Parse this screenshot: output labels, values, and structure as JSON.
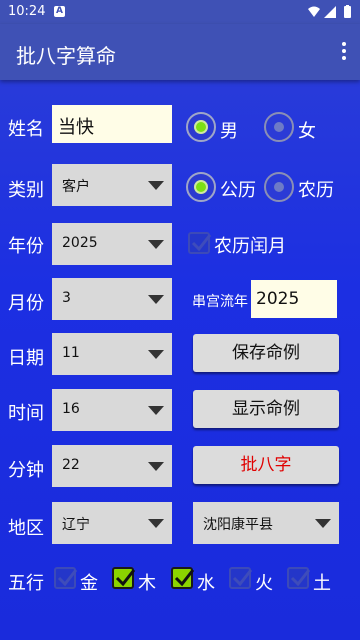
{
  "status_bar": {
    "time": "10:24",
    "notification_glyph": "A"
  },
  "app_bar": {
    "title": "批八字算命"
  },
  "form": {
    "name_label": "姓名",
    "name_value": "当快",
    "gender_male": "男",
    "gender_female": "女",
    "gender_selected": "男",
    "category_label": "类别",
    "category_value": "客户",
    "calendar_solar": "公历",
    "calendar_lunar": "农历",
    "calendar_selected": "公历",
    "year_label": "年份",
    "year_value": "2025",
    "leap_month_label": "农历闰月",
    "leap_month_checked": false,
    "month_label": "月份",
    "month_value": "3",
    "flow_year_label": "串宫流年",
    "flow_year_value": "2025",
    "day_label": "日期",
    "day_value": "11",
    "hour_label": "时间",
    "hour_value": "16",
    "minute_label": "分钟",
    "minute_value": "22",
    "region_label": "地区",
    "province_value": "辽宁",
    "city_value": "沈阳康平县"
  },
  "buttons": {
    "save_case": "保存命例",
    "show_case": "显示命例",
    "compute": "批八字"
  },
  "elements": {
    "label": "五行",
    "items": [
      {
        "name": "金",
        "checked": false
      },
      {
        "name": "木",
        "checked": true
      },
      {
        "name": "水",
        "checked": true
      },
      {
        "name": "火",
        "checked": false
      },
      {
        "name": "土",
        "checked": false
      }
    ]
  },
  "colors": {
    "app_bar": "#3f51b5",
    "background": "#1c2fe2",
    "accent_check": "#8bd400",
    "compute_text": "#e00000"
  }
}
